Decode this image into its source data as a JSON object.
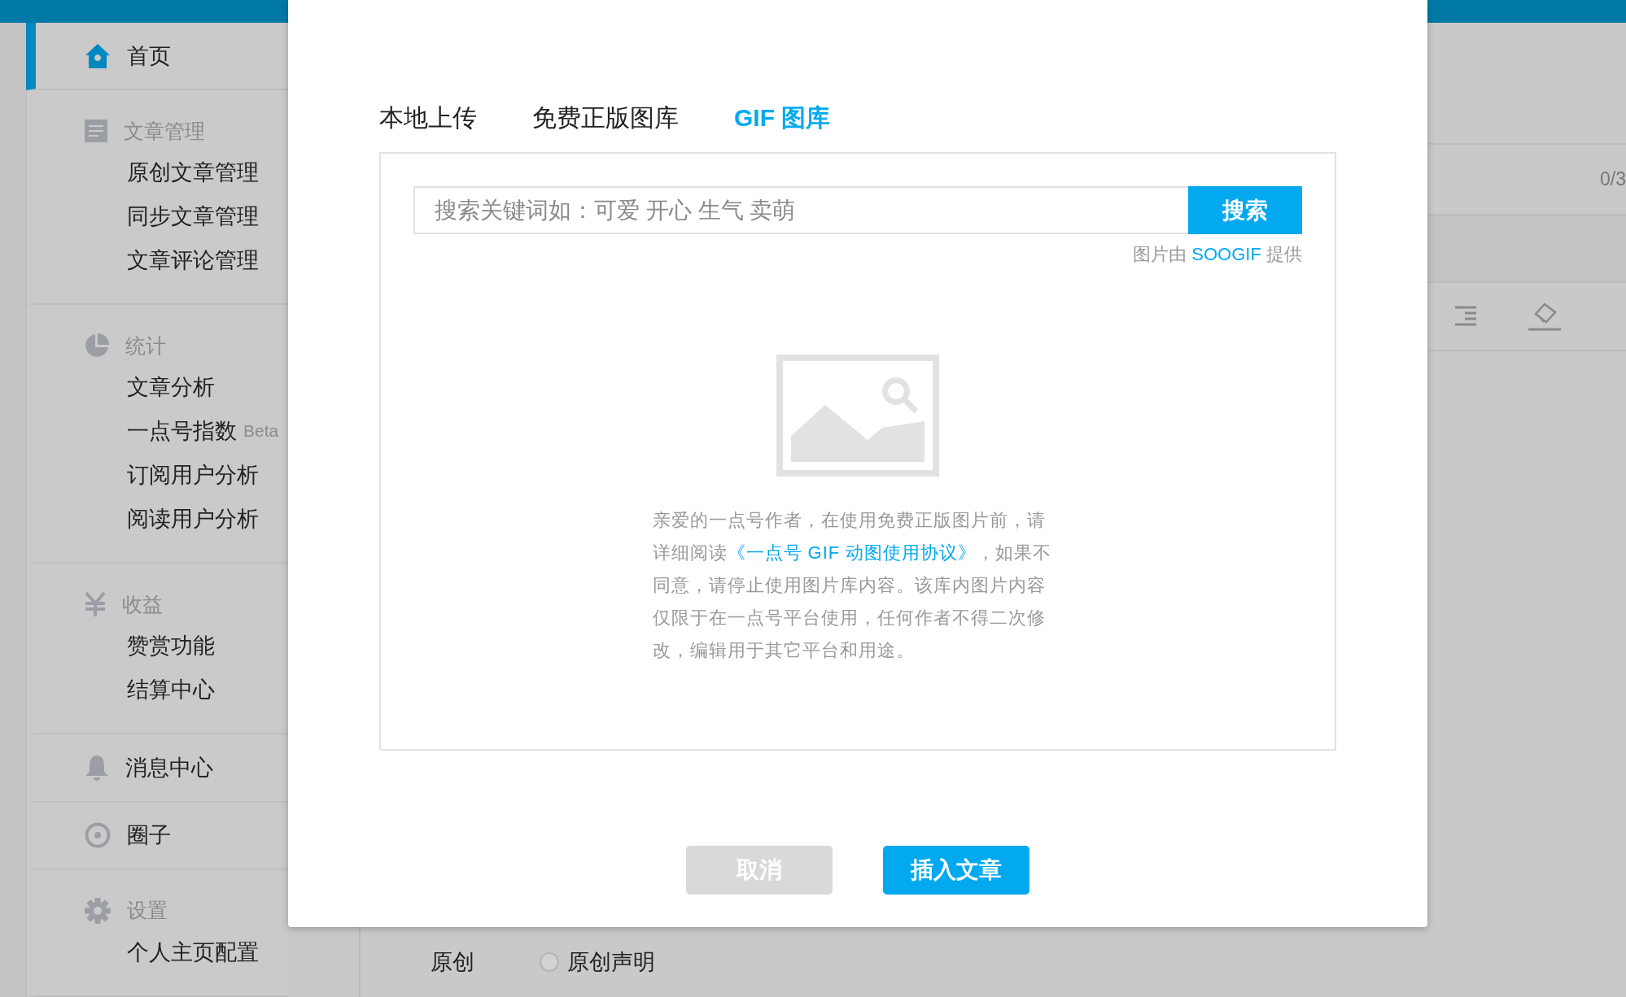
{
  "sidebar": {
    "sections": [
      {
        "kind": "link",
        "label": "首页",
        "selected": true
      },
      {
        "kind": "group",
        "title": "文章管理",
        "items": [
          {
            "label": "原创文章管理",
            "selected": false
          },
          {
            "label": "同步文章管理",
            "selected": false
          },
          {
            "label": "文章评论管理",
            "selected": false
          }
        ]
      },
      {
        "kind": "group",
        "title": "统计",
        "items": [
          {
            "label": "文章分析",
            "selected": false
          },
          {
            "label": "一点号指数",
            "badge": "Beta",
            "selected": false
          },
          {
            "label": "订阅用户分析",
            "selected": false
          },
          {
            "label": "阅读用户分析",
            "selected": false
          }
        ]
      },
      {
        "kind": "group",
        "title": "收益",
        "items": [
          {
            "label": "赞赏功能",
            "selected": false
          },
          {
            "label": "结算中心",
            "selected": false
          }
        ]
      },
      {
        "kind": "link",
        "label": "消息中心",
        "selected": false
      },
      {
        "kind": "link",
        "label": "圈子",
        "selected": false
      },
      {
        "kind": "group",
        "title": "设置",
        "items": [
          {
            "label": "个人主页配置",
            "selected": false
          }
        ]
      }
    ]
  },
  "editor": {
    "title_counter": "0/3",
    "original_label": "原创",
    "original_option": {
      "label": "原创声明",
      "checked": false
    }
  },
  "dialog": {
    "tabs": [
      {
        "label": "本地上传",
        "selected": false
      },
      {
        "label": "免费正版图库",
        "selected": false
      },
      {
        "label": "GIF 图库",
        "selected": true
      }
    ],
    "search": {
      "placeholder": "搜索关键词如：可爱 开心 生气 卖萌",
      "button": "搜索"
    },
    "credit": {
      "prefix": "图片由",
      "brand": "SOOGIF",
      "suffix": "提供"
    },
    "notice": {
      "before": "亲爱的一点号作者，在使用免费正版图片前，请详细阅读",
      "link": "《一点号 GIF 动图使用协议》",
      "after": "，如果不同意，请停止使用图片库内容。该库内图片内容仅限于在一点号平台使用，任何作者不得二次修改，编辑用于其它平台和用途。"
    },
    "buttons": [
      {
        "label": "取消",
        "kind": "cancel"
      },
      {
        "label": "插入文章",
        "kind": "primary"
      }
    ]
  }
}
